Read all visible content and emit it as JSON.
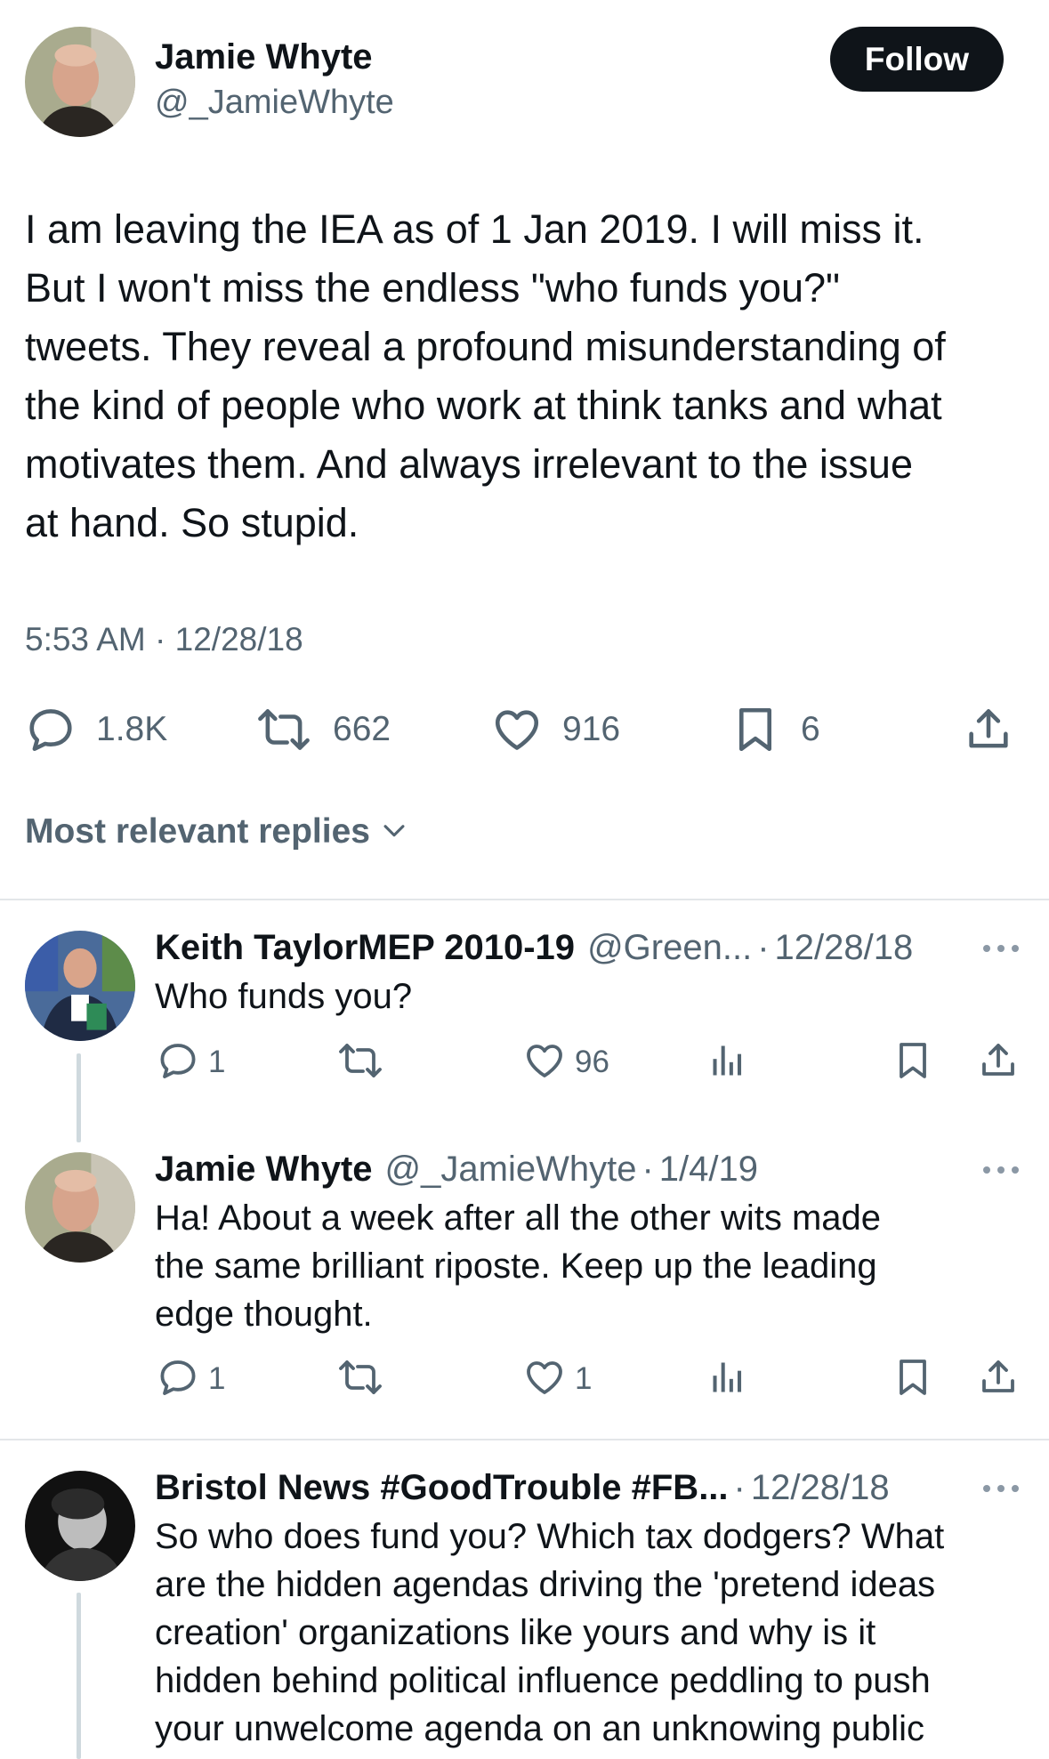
{
  "tweet": {
    "author_name": "Jamie Whyte",
    "author_handle": "@_JamieWhyte",
    "follow_label": "Follow",
    "text_lines": [
      "I am leaving the IEA as of 1 Jan 2019. I will miss it.",
      "But I won't miss the endless \"who funds you?\"",
      "tweets. They reveal a profound misunderstanding of",
      "the kind of people who work at think tanks and what",
      "motivates them. And always irrelevant to the issue",
      "at hand. So stupid."
    ],
    "timestamp": "5:53 AM · 12/28/18",
    "stats": {
      "replies": "1.8K",
      "reposts": "662",
      "likes": "916",
      "bookmarks": "6"
    }
  },
  "replies_header": {
    "label": "Most relevant replies"
  },
  "replies": [
    {
      "name": "Keith TaylorMEP 2010-19",
      "handle": "@Green...",
      "dot": "·",
      "date": "12/28/18",
      "text_lines": [
        "Who funds you?"
      ],
      "replies": "1",
      "likes": "96"
    },
    {
      "name": "Jamie Whyte",
      "handle": "@_JamieWhyte",
      "dot": "·",
      "date": "1/4/19",
      "text_lines": [
        "Ha! About a week after all the other wits made",
        "the same brilliant riposte. Keep up the leading",
        "edge thought."
      ],
      "replies": "1",
      "likes": "1"
    },
    {
      "name": "Bristol News #GoodTrouble #FB...",
      "dot": "·",
      "date": "12/28/18",
      "text_lines": [
        "So who does fund you? Which tax dodgers? What",
        "are the hidden agendas driving the 'pretend ideas",
        "creation' organizations like yours and why is it",
        "hidden behind political influence peddling to push",
        "your unwelcome agenda on an unknowing public"
      ]
    }
  ],
  "colors": {
    "text_primary": "#0f1419",
    "text_secondary": "#536471",
    "divider": "#e3e6e9",
    "follow_bg": "#0f1419",
    "thread_line": "#cfd9de"
  },
  "icons": [
    "reply-icon",
    "repost-icon",
    "like-icon",
    "bookmark-icon",
    "share-icon",
    "analytics-icon",
    "more-icon",
    "chevron-down-icon"
  ]
}
